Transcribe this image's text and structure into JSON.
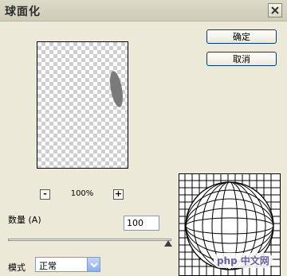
{
  "window": {
    "title": "球面化",
    "close_glyph": "✕"
  },
  "buttons": {
    "ok_label": "确定",
    "cancel_label": "取消"
  },
  "zoom": {
    "minus_label": "-",
    "plus_label": "+",
    "level": "100%"
  },
  "amount": {
    "label": "数量 (A)",
    "value": "100",
    "unit": "%",
    "slider_fraction": 1.0
  },
  "mode": {
    "label": "模式",
    "selected": "正常"
  },
  "watermark": {
    "text": "php 中文网"
  },
  "colors": {
    "dialog_bg": "#ece9d8",
    "button_border": "#003c74",
    "input_border": "#7f9db9"
  }
}
